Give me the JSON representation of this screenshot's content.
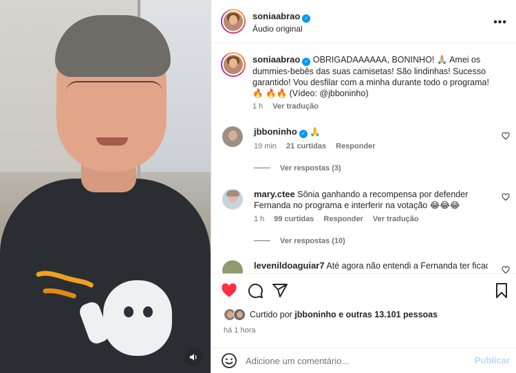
{
  "header": {
    "username": "soniaabrao",
    "subtitle": "Áudio original",
    "more_label": "•••"
  },
  "caption": {
    "username": "soniaabrao",
    "text": "OBRIGADAAAAAA, BONINHO! 🙏🏼 Amei os dummies-bebês das suas camisetas! São lindinhas! Sucesso garantido! Vou desfilar com a minha durante todo o programa! 🔥 🔥🔥 (Vídeo: @jbboninho)",
    "time": "1 h",
    "translate": "Ver tradução"
  },
  "comments": [
    {
      "username": "jbboninho",
      "text": "🙏",
      "time": "19 min",
      "likes": "21 curtidas",
      "reply": "Responder",
      "replies": "Ver respostas (3)"
    },
    {
      "username": "mary.ctee",
      "text": "Sônia ganhando a recompensa por defender Fernanda no programa e interferir na votação 😂😂😂",
      "time": "1 h",
      "likes": "99 curtidas",
      "reply": "Responder",
      "translate": "Ver tradução",
      "replies": "Ver respostas (10)"
    },
    {
      "username": "levenildoaguiar7",
      "text": "Até agora não entendi a Fernanda ter ficado"
    }
  ],
  "likes": {
    "prefix": "Curtido por",
    "user": "jbboninho",
    "suffix": "e outras 13.101 pessoas"
  },
  "post_time": "há 1 hora",
  "composer": {
    "placeholder": "Adicione um comentário...",
    "publish": "Publicar"
  },
  "colors": {
    "like_red": "#ff3040",
    "verified_blue": "#0095f6",
    "publish_disabled": "#b3dbff"
  }
}
